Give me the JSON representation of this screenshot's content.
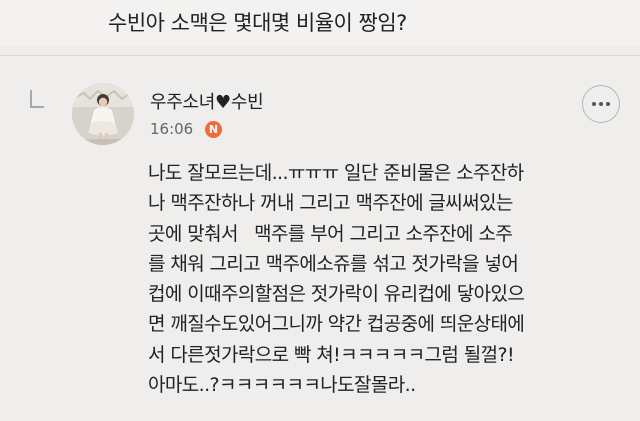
{
  "post": {
    "question": "수빈아 소맥은 몇대몇 비율이 짱임?"
  },
  "comment": {
    "author": {
      "name_prefix": "우주소녀",
      "heart": "♥",
      "name_suffix": "수빈"
    },
    "timestamp": "16:06",
    "new_badge": "N",
    "more_icon": "more-horizontal-icon",
    "badge_color": "#f06a3d",
    "body_lines": [
      "나도 잘모르는데...ㅠㅠㅠ 일단 준비물은 소주잔하",
      "나 맥주잔하나 꺼내 그리고 맥주잔에 글씨써있는",
      "곳에 맞춰서   맥주를 부어 그리고 소주잔에 소주",
      "를 채워 그리고 맥주에소쥬를 섞고 젓가락을 넣어",
      "컵에 이때주의할점은 젓가락이 유리컵에 닿아있으",
      "면 깨질수도있어그니까 약간 컵공중에 띄운상태에",
      "서 다른젓가락으로 빡 쳐!ㅋㅋㅋㅋㅋ그럼 될껄?!",
      "아마도..?ㅋㅋㅋㅋㅋㅋ나도잘몰라.."
    ]
  }
}
